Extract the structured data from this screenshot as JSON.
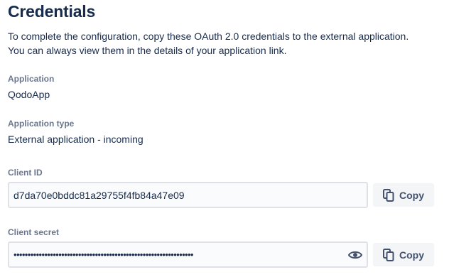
{
  "title": "Credentials",
  "description": {
    "line1": "To complete the configuration, copy these OAuth 2.0 credentials to the external application.",
    "line2": "You can always view them in the details of your application link."
  },
  "application": {
    "label": "Application",
    "value": "QodoApp"
  },
  "application_type": {
    "label": "Application type",
    "value": "External application - incoming"
  },
  "client_id": {
    "label": "Client ID",
    "value": "d7da70e0bddc81a29755f4fb84a47e09",
    "copy_label": "Copy",
    "copy_icon": "copy-icon"
  },
  "client_secret": {
    "label": "Client secret",
    "masked_value": "••••••••••••••••••••••••••••••••••••••••••••••••••••••••••••••••",
    "copy_label": "Copy",
    "copy_icon": "copy-icon",
    "reveal_icon": "eye-icon"
  },
  "colors": {
    "text": "#172b4d",
    "label": "#6b778c",
    "button_bg": "#f4f5f7",
    "field_border": "#dfe1e6"
  }
}
